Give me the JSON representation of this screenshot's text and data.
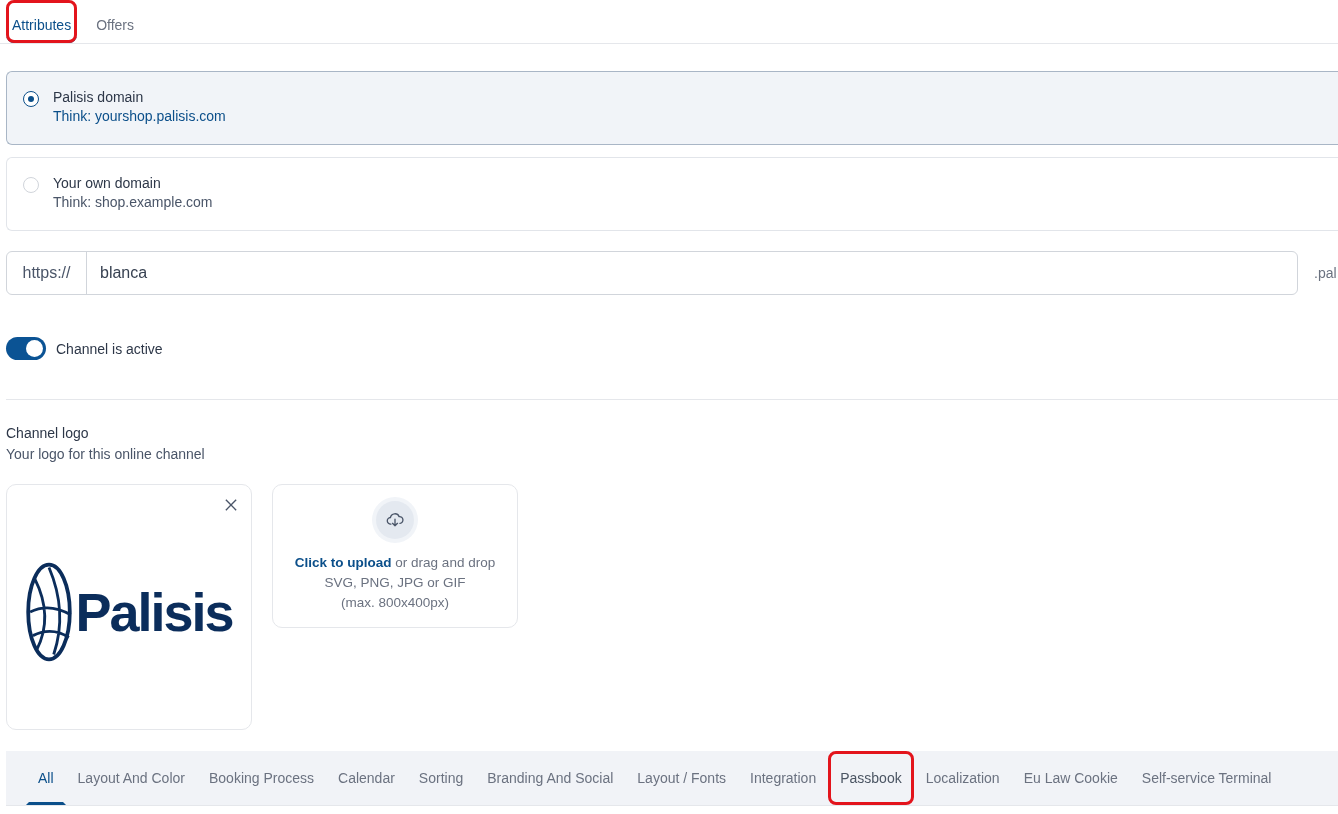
{
  "tabs": [
    {
      "label": "Attributes",
      "selected": true,
      "highlighted": true
    },
    {
      "label": "Offers",
      "selected": false,
      "highlighted": false
    }
  ],
  "domain_options": [
    {
      "title": "Palisis domain",
      "hint": "Think: yourshop.palisis.com",
      "selected": true
    },
    {
      "title": "Your own domain",
      "hint": "Think: shop.example.com",
      "selected": false
    }
  ],
  "url_field": {
    "prefix": "https://",
    "value": "blanca",
    "suffix": ".pal"
  },
  "channel_toggle": {
    "label": "Channel is active",
    "on": true
  },
  "channel_logo": {
    "title": "Channel logo",
    "subtitle": "Your logo for this online channel",
    "logo_text": "Palisis",
    "upload": {
      "link": "Click to upload",
      "text": "or drag and drop SVG, PNG, JPG or GIF",
      "limit": "(max. 800x400px)"
    }
  },
  "category_tabs": [
    {
      "label": "All",
      "selected": true,
      "highlighted": false
    },
    {
      "label": "Layout And Color",
      "selected": false,
      "highlighted": false
    },
    {
      "label": "Booking Process",
      "selected": false,
      "highlighted": false
    },
    {
      "label": "Calendar",
      "selected": false,
      "highlighted": false
    },
    {
      "label": "Sorting",
      "selected": false,
      "highlighted": false
    },
    {
      "label": "Branding And Social",
      "selected": false,
      "highlighted": false
    },
    {
      "label": "Layout / Fonts",
      "selected": false,
      "highlighted": false
    },
    {
      "label": "Integration",
      "selected": false,
      "highlighted": false
    },
    {
      "label": "Passbook",
      "selected": false,
      "highlighted": true
    },
    {
      "label": "Localization",
      "selected": false,
      "highlighted": false
    },
    {
      "label": "Eu Law Cookie",
      "selected": false,
      "highlighted": false
    },
    {
      "label": "Self-service Terminal",
      "selected": false,
      "highlighted": false
    }
  ]
}
